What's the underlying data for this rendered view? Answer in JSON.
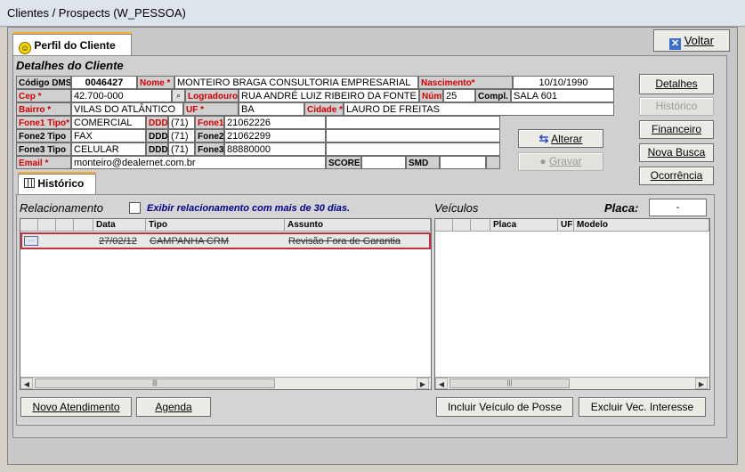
{
  "window": {
    "title": "Clientes / Prospects (W_PESSOA)"
  },
  "tabs": {
    "perfil": "Perfil do Cliente",
    "historico": "Histórico"
  },
  "buttons": {
    "voltar": "Voltar",
    "detalhes": "Detalhes",
    "historico": "Histórico",
    "financeiro": "Financeiro",
    "nova_busca": "Nova Busca",
    "ocorrencia": "Ocorrência",
    "alterar": "Alterar",
    "gravar": "Gravar",
    "novo_atendimento": "Novo Atendimento",
    "agenda": "Agenda",
    "incluir_veiculo": "Incluir Veículo de Posse",
    "excluir_vec": "Excluir Vec. Interesse"
  },
  "details": {
    "section_title": "Detalhes do Cliente",
    "labels": {
      "codigo": "Código DMS",
      "nome": "Nome *",
      "nascimento": "Nascimento*",
      "cep": "Cep *",
      "logradouro": "Logradouro*",
      "num": "Núm*",
      "compl": "Compl.",
      "bairro": "Bairro *",
      "uf": "UF *",
      "cidade": "Cidade *",
      "fone1tipo": "Fone1 Tipo*",
      "ddd": "DDD",
      "fone1": "Fone1",
      "fone2tipo": "Fone2 Tipo",
      "fone2": "Fone2",
      "fone3tipo": "Fone3 Tipo",
      "fone3": "Fone3",
      "email": "Email *",
      "score": "SCORE",
      "smd": "SMD"
    },
    "values": {
      "codigo": "0046427",
      "nome": "MONTEIRO BRAGA CONSULTORIA EMPRESARIAL",
      "nascimento": "10/10/1990",
      "cep": "42.700-000",
      "logradouro": "RUA ANDRÉ LUIZ RIBEIRO DA FONTE",
      "num": "25",
      "compl": "SALA 601",
      "bairro": "VILAS DO ATLÂNTICO",
      "uf": "BA",
      "cidade": "LAURO DE FREITAS",
      "fone1tipo": "COMERCIAL",
      "ddd1": "(71)",
      "fone1": "21062226",
      "fone2tipo": "FAX",
      "ddd2": "(71)",
      "fone2": "21062299",
      "fone3tipo": "CELULAR",
      "ddd3": "(71)",
      "fone3": "88880000",
      "email": "monteiro@dealernet.com.br",
      "score": "",
      "smd": ""
    }
  },
  "relacionamento": {
    "title": "Relacionamento",
    "checkbox_label": "Exibir relacionamento com mais de 30 dias.",
    "checked": false,
    "columns": [
      "Data",
      "Tipo",
      "Assunto"
    ],
    "rows": [
      {
        "data": "27/02/12",
        "tipo": "CAMPANHA CRM",
        "assunto": "Revisão Fora de Garantia"
      }
    ]
  },
  "veiculos": {
    "title": "Veículos",
    "placa_label": "Placa:",
    "placa_value": "-",
    "columns": [
      "Placa",
      "UF",
      "Modelo"
    ]
  },
  "colors": {
    "required": "#d40000",
    "checkbox_text": "#00008b",
    "highlight": "#c03040"
  }
}
